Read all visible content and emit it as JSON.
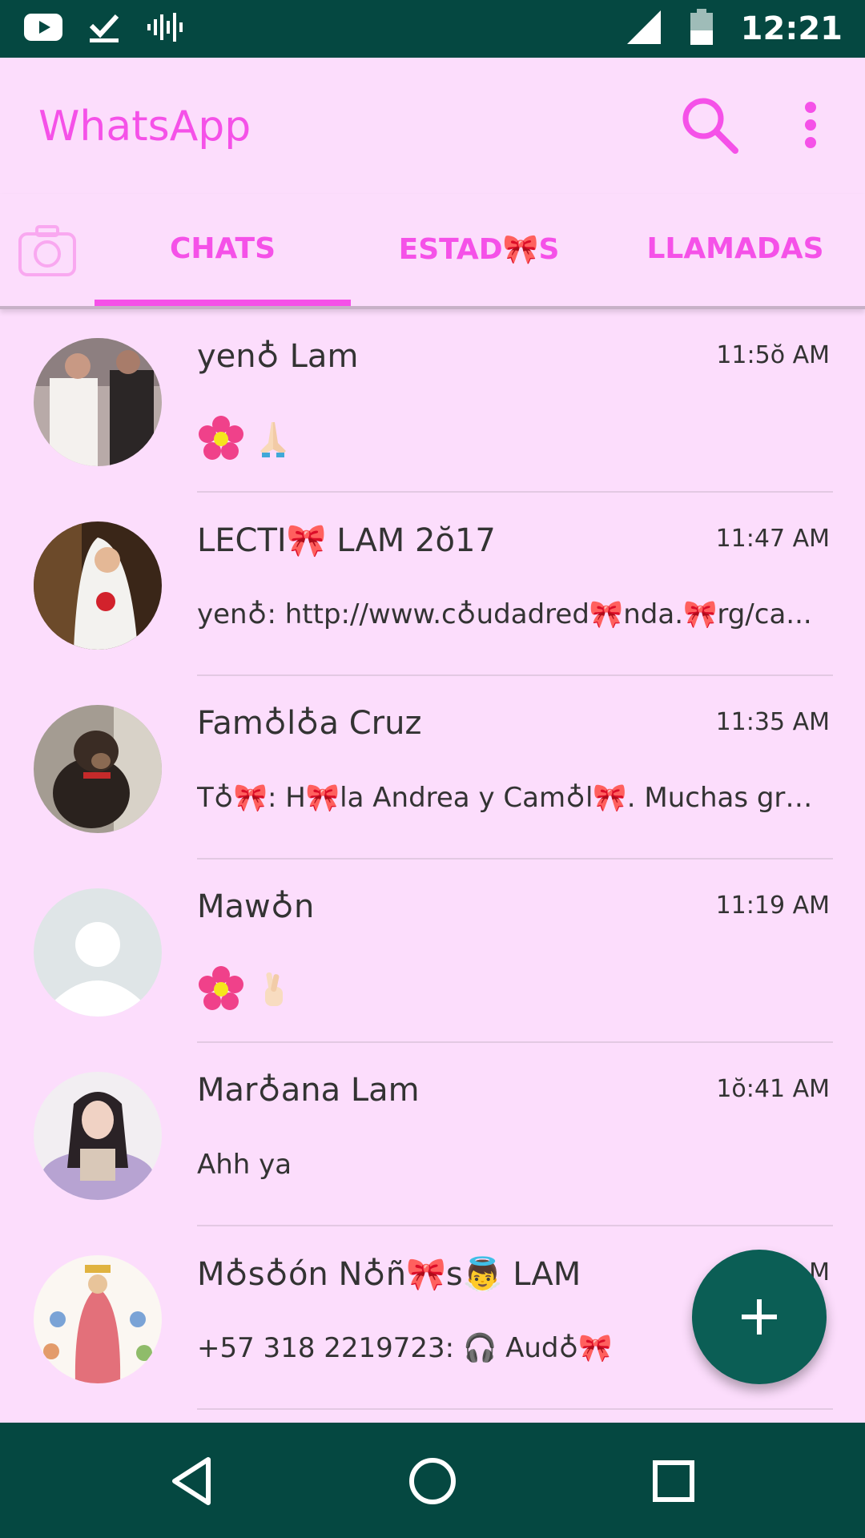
{
  "status_bar": {
    "time": "12:21",
    "icons": [
      "youtube-icon",
      "check-icon",
      "audio-wave-icon",
      "signal-icon",
      "battery-icon"
    ]
  },
  "app_bar": {
    "title": "WhatsApp",
    "icons": [
      "search-icon",
      "more-vert-icon"
    ]
  },
  "tabs": {
    "camera_icon": "camera-icon",
    "items": [
      {
        "label": "CHATS",
        "selected": true
      },
      {
        "label": "ESTAD🎀S",
        "selected": false
      },
      {
        "label": "LLAMADAS",
        "selected": false
      }
    ]
  },
  "chats": [
    {
      "name": "yen♁ Lam",
      "time": "11:5ŏ AM",
      "message": ""
    },
    {
      "name": "LECTI🎀 LAM 2ŏ17",
      "time": "11:47 AM",
      "message": "yen♁: http://www.c♁udadred🎀nda.🎀rg/ca..."
    },
    {
      "name": "Fam♁l♁a Cruz",
      "time": "11:35 AM",
      "message": "T♁🎀: H🎀la Andrea y Cam♁l🎀. Muchas gra..."
    },
    {
      "name": "Maw♁n",
      "time": "11:19 AM",
      "message": ""
    },
    {
      "name": "Mar♁ana Lam",
      "time": "1ŏ:41 AM",
      "message": "Ahh ya"
    },
    {
      "name": "M♁s♁ón N♁ñ🎀s👼 LAM",
      "time": "M",
      "message": "+57 318 2219723: 🎧 Aud♁🎀"
    }
  ],
  "fab": {
    "icon": "plus-icon"
  },
  "nav_bar": {
    "icons": [
      "back-icon",
      "home-icon",
      "recents-icon"
    ]
  },
  "colors": {
    "accent": "#F551E8",
    "background": "#FCDDFC",
    "status_bar": "#054841",
    "fab": "#0B5E55"
  }
}
